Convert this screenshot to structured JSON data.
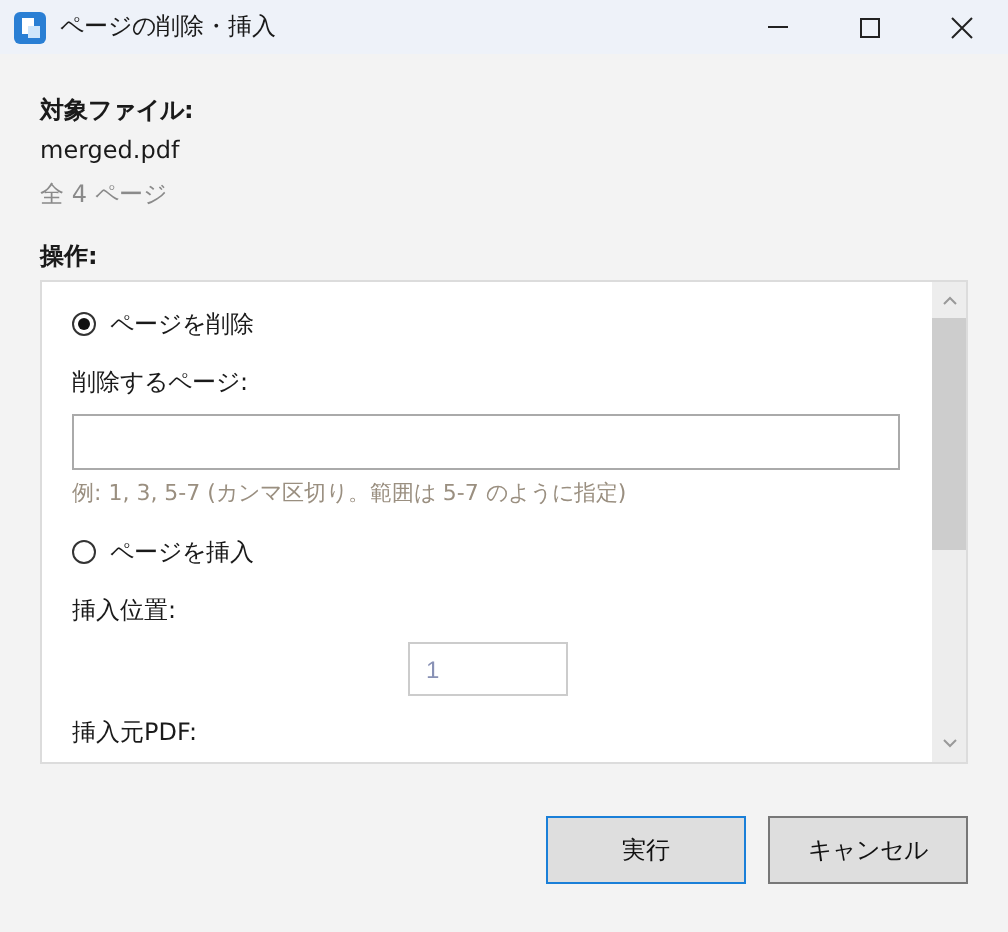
{
  "window": {
    "title": "ページの削除・挿入"
  },
  "target_file": {
    "label": "対象ファイル:",
    "name": "merged.pdf",
    "pages": "全 4 ページ"
  },
  "operation": {
    "label": "操作:",
    "items": [
      {
        "kind": "radio",
        "label": "ページを削除",
        "selected": true
      },
      {
        "kind": "label",
        "text": "削除するページ:"
      },
      {
        "kind": "text_field"
      },
      {
        "kind": "hint",
        "text": "例: 1, 3, 5-7 (カンマ区切り。範囲は 5-7 のように指定)"
      },
      {
        "kind": "radio",
        "label": "ページを挿入",
        "selected": false
      },
      {
        "kind": "label",
        "text": "挿入位置:"
      },
      {
        "kind": "number_field",
        "value": "1",
        "disabled": true
      },
      {
        "kind": "label",
        "text": "挿入元PDF:"
      }
    ]
  },
  "buttons": [
    {
      "label": "実行",
      "default": true
    },
    {
      "label": "キャンセル",
      "default": false
    }
  ]
}
